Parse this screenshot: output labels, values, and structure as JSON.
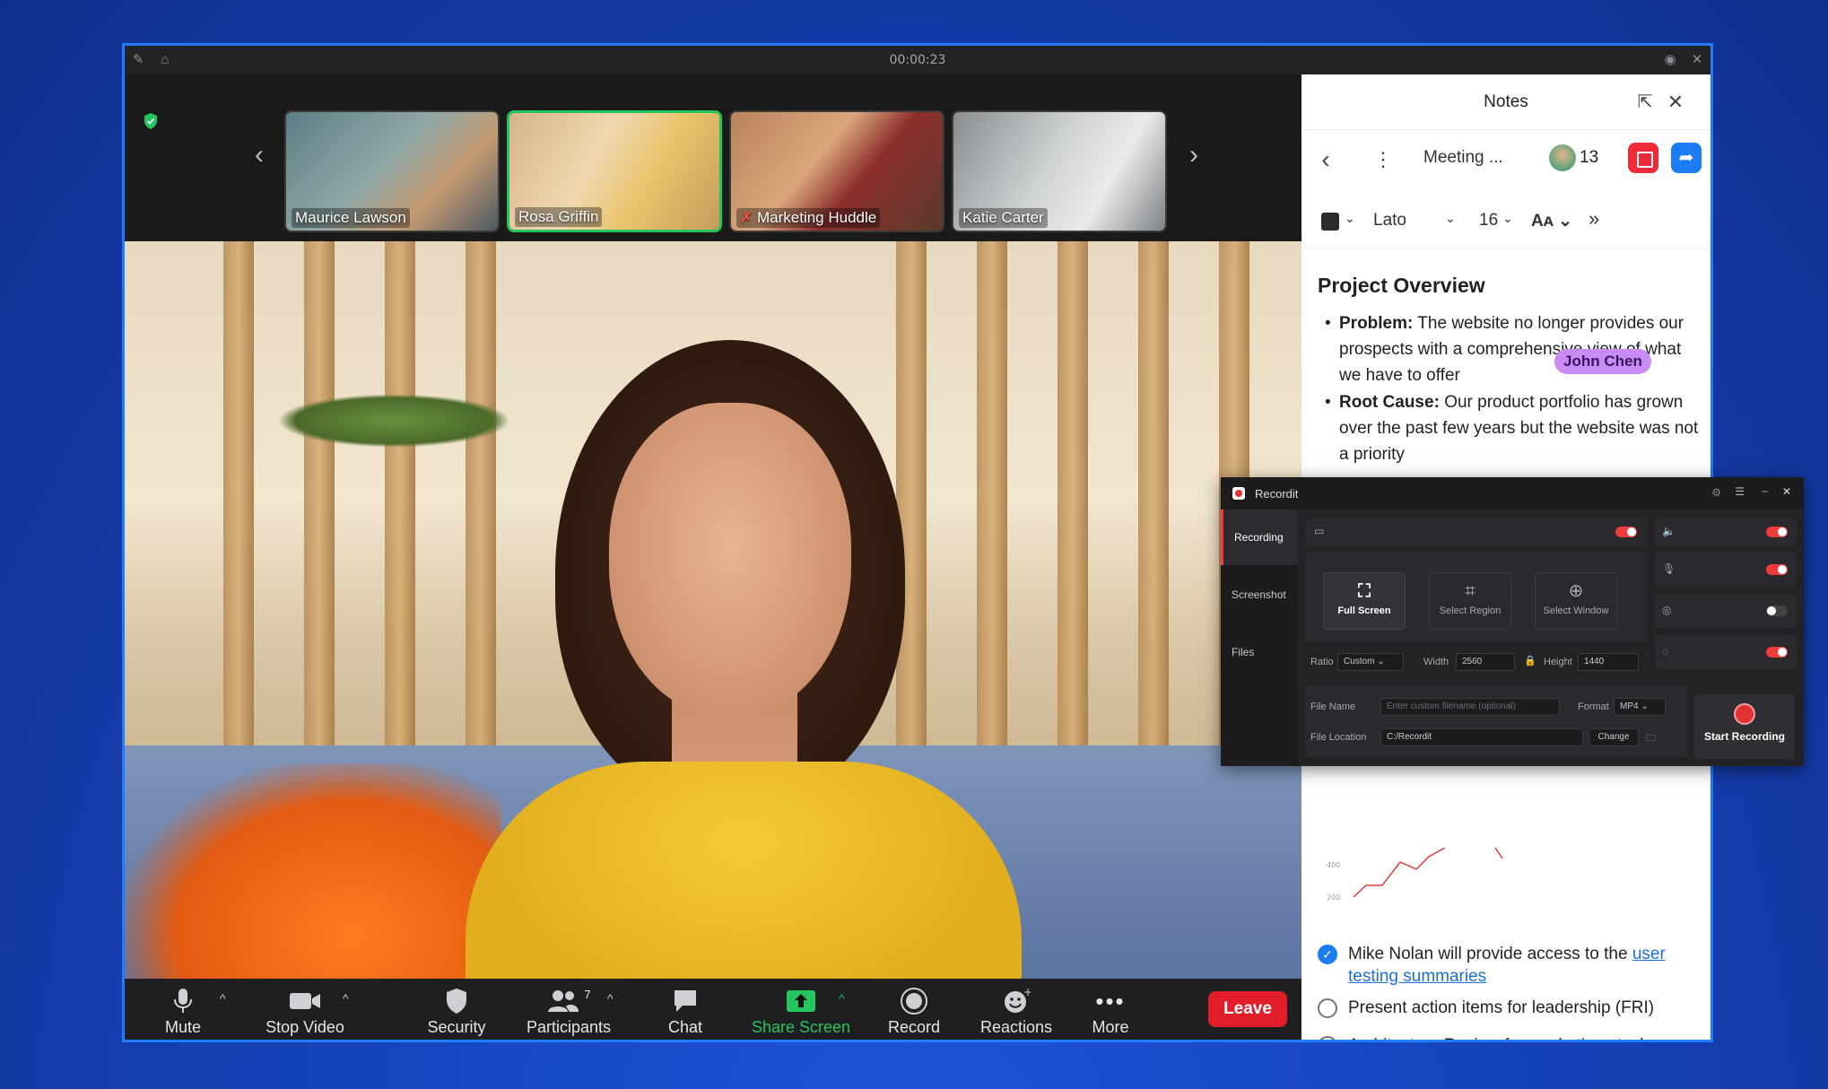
{
  "window": {
    "timer": "00:00:23"
  },
  "participants": [
    {
      "name": "Maurice Lawson"
    },
    {
      "name": "Rosa Griffin"
    },
    {
      "name": "Marketing Huddle"
    },
    {
      "name": "Katie Carter"
    }
  ],
  "toolbar": {
    "mute": "Mute",
    "stop_video": "Stop Video",
    "security": "Security",
    "participants": "Participants",
    "participants_count": "7",
    "chat": "Chat",
    "share_screen": "Share Screen",
    "record": "Record",
    "reactions": "Reactions",
    "more": "More",
    "leave": "Leave"
  },
  "notes": {
    "title": "Notes",
    "meeting": "Meeting ...",
    "collaborators": "13",
    "font": "Lato",
    "size": "16",
    "heading": "Project Overview",
    "problem_label": "Problem:",
    "problem_text": "The website no longer provides our prospects with a comprehensive view of what we have to offer",
    "rootcause_label": "Root Cause:",
    "rootcause_text": "Our product portfolio has grown over the past few years but the website was not a priority",
    "cursor_user": "John Chen",
    "chart_ticks": [
      "400",
      "200"
    ],
    "todos": [
      {
        "text": "Mike Nolan will provide access to the ",
        "link": "user testing summaries",
        "checked": true
      },
      {
        "text": "Present action items for leadership (FRI)",
        "checked": false
      },
      {
        "text": "Architecture Review for marketing stack changes",
        "checked": false
      }
    ]
  },
  "recordit": {
    "title": "Recordit",
    "tabs": [
      "Recording",
      "Screenshot",
      "Files"
    ],
    "modes": [
      "Full Screen",
      "Select Region",
      "Select Window"
    ],
    "ratio_label": "Ratio",
    "ratio_value": "Custom",
    "width_label": "Width",
    "width_value": "2560",
    "height_label": "Height",
    "height_value": "1440",
    "file_name_label": "File Name",
    "file_name_placeholder": "Enter custom filename (optional)",
    "format_label": "Format",
    "format_value": "MP4",
    "file_location_label": "File Location",
    "file_location_value": "C:/Recordit",
    "change_label": "Change",
    "start_label": "Start Recording"
  },
  "colors": {
    "accent": "#1f7cff",
    "leave": "#e11d2a",
    "active_tile": "#22c55e",
    "record_red": "#ef3b3b"
  }
}
